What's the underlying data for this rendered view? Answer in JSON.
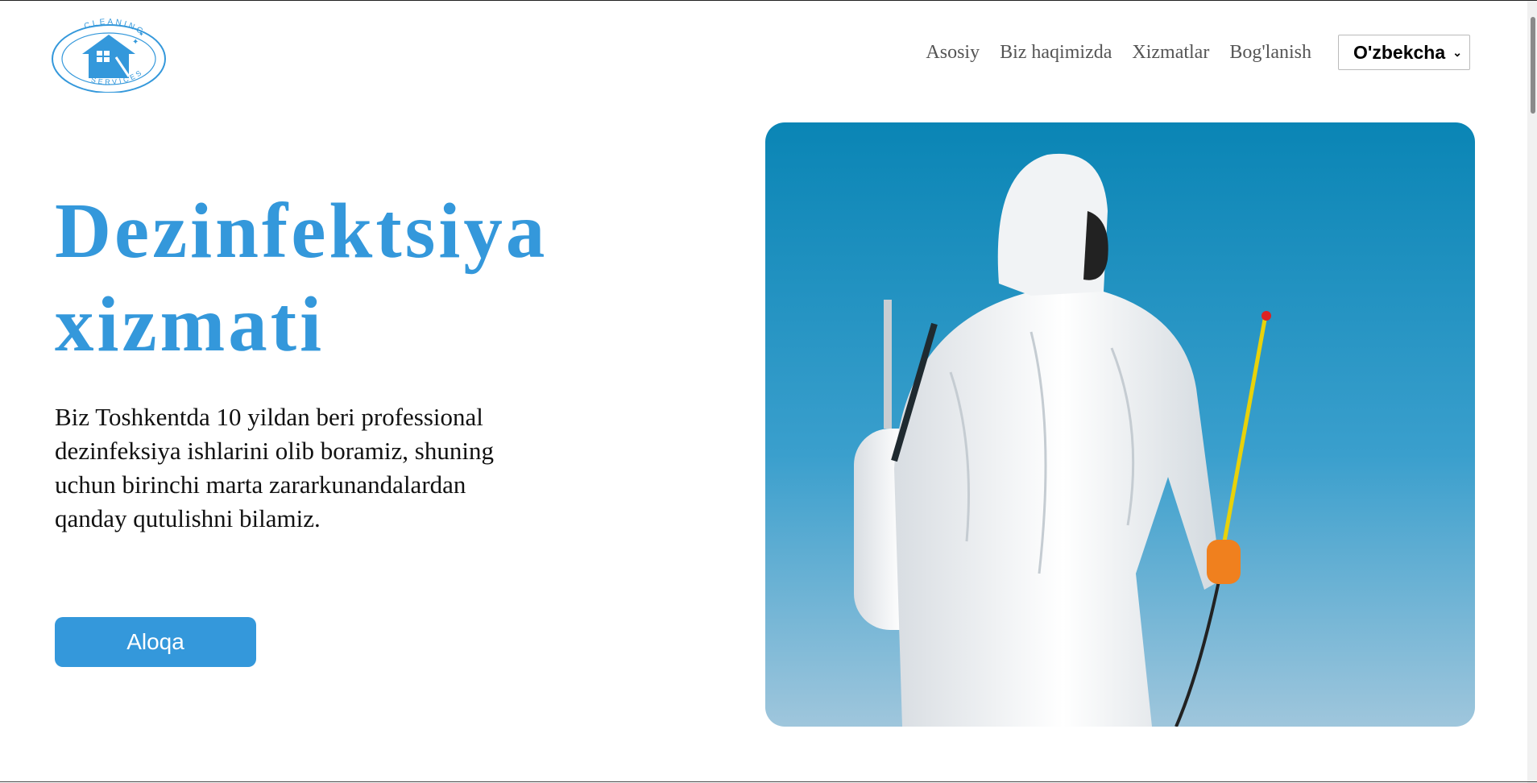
{
  "brand": {
    "logo_top_text": "CLEANING",
    "logo_bottom_text": "SERVICES",
    "accent_color": "#3498db",
    "icon": "house-logo-icon"
  },
  "nav": {
    "items": [
      {
        "label": "Asosiy"
      },
      {
        "label": "Biz haqimizda"
      },
      {
        "label": "Xizmatlar"
      },
      {
        "label": "Bog'lanish"
      }
    ],
    "language_selected": "O'zbekcha"
  },
  "hero": {
    "title_line1": "Dezinfektsiya",
    "title_line2": "xizmati",
    "description": "Biz Toshkentda 10 yildan beri professional dezinfeksiya ishlarini olib boramiz, shuning uchun birinchi marta zararkunandalardan qanday qutulishni bilamiz.",
    "cta_label": "Aloqa"
  }
}
